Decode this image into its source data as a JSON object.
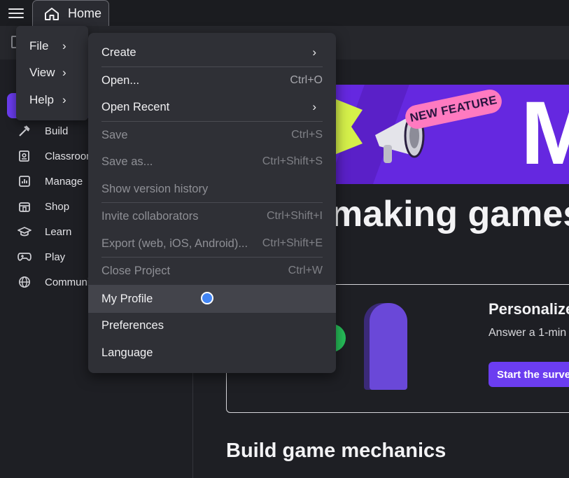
{
  "topbar": {
    "home_tab_label": "Home"
  },
  "sidebar": {
    "items": [
      {
        "label": "Build",
        "icon": "hammer-icon"
      },
      {
        "label": "Classroom",
        "icon": "classroom-icon"
      },
      {
        "label": "Manage",
        "icon": "chart-icon"
      },
      {
        "label": "Shop",
        "icon": "shop-icon"
      },
      {
        "label": "Learn",
        "icon": "graduation-cap-icon"
      },
      {
        "label": "Play",
        "icon": "gamepad-icon"
      },
      {
        "label": "Community",
        "icon": "globe-icon"
      }
    ]
  },
  "main_menu": {
    "items": [
      {
        "label": "File",
        "chevron": "›"
      },
      {
        "label": "View",
        "chevron": "›"
      },
      {
        "label": "Help",
        "chevron": "›"
      }
    ]
  },
  "file_menu": {
    "create": {
      "label": "Create",
      "chevron": "›"
    },
    "open": {
      "label": "Open...",
      "shortcut": "Ctrl+O"
    },
    "open_recent": {
      "label": "Open Recent",
      "chevron": "›"
    },
    "save": {
      "label": "Save",
      "shortcut": "Ctrl+S"
    },
    "save_as": {
      "label": "Save as...",
      "shortcut": "Ctrl+Shift+S"
    },
    "version_history": {
      "label": "Show version history"
    },
    "invite": {
      "label": "Invite collaborators",
      "shortcut": "Ctrl+Shift+I"
    },
    "export": {
      "label": "Export (web, iOS, Android)...",
      "shortcut": "Ctrl+Shift+E"
    },
    "close": {
      "label": "Close Project",
      "shortcut": "Ctrl+W"
    },
    "my_profile": {
      "label": "My Profile"
    },
    "preferences": {
      "label": "Preferences"
    },
    "language": {
      "label": "Language"
    }
  },
  "main": {
    "banner_badge": "NEW FEATURE",
    "banner_letter": "M",
    "heading_making": "making games",
    "card_title": "Personalize",
    "card_text": "Answer a 1-min",
    "survey_button": "Start the survey",
    "heading_build": "Build game mechanics"
  },
  "colors": {
    "accent": "#6b3df0",
    "banner": "#6528e0",
    "badge_pink": "#ff7ac0",
    "cursor_blue": "#4285f4"
  }
}
